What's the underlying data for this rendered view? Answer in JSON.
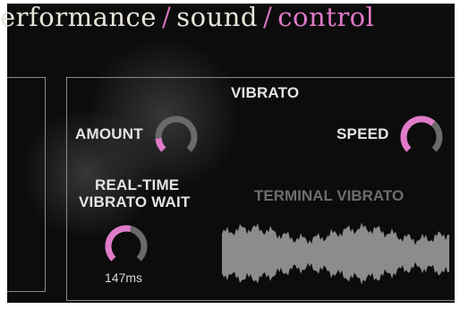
{
  "nav": {
    "items": [
      {
        "label": "erformance",
        "active": false
      },
      {
        "label": "sound",
        "active": false
      },
      {
        "label": "control",
        "active": true
      }
    ],
    "separator": "/"
  },
  "vibrato": {
    "title": "VIBRATO",
    "amount": {
      "label": "AMOUNT",
      "level": 0.15
    },
    "speed": {
      "label": "SPEED",
      "level": 0.65
    }
  },
  "realtime": {
    "label_line1": "REAL-TIME",
    "label_line2": "VIBRATO WAIT",
    "value": "147ms",
    "level": 0.55
  },
  "terminal_vibrato": {
    "label": "TERMINAL VIBRATO"
  },
  "colors": {
    "accent": "#e07ac9",
    "knob_track": "#6a6a6a",
    "text": "#e4e4e4",
    "border": "#8a8a8a"
  }
}
